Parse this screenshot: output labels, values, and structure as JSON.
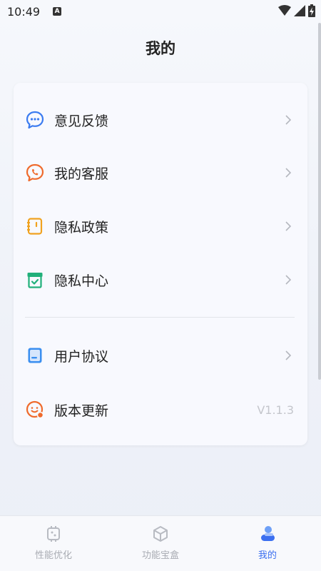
{
  "status_bar": {
    "time": "10:49",
    "notification_letter": "A"
  },
  "header": {
    "title": "我的"
  },
  "menu": {
    "items": [
      {
        "label": "意见反馈",
        "icon": "feedback-chat-icon",
        "color": "#3b7bf0"
      },
      {
        "label": "我的客服",
        "icon": "customer-service-phone-icon",
        "color": "#ef6a2c"
      },
      {
        "label": "隐私政策",
        "icon": "privacy-policy-notebook-icon",
        "color": "#f0a21f"
      },
      {
        "label": "隐私中心",
        "icon": "privacy-center-box-icon",
        "color": "#21b07a"
      }
    ],
    "secondary_items": [
      {
        "label": "用户协议",
        "icon": "user-agreement-icon",
        "color": "#3b8ff0"
      },
      {
        "label": "版本更新",
        "icon": "version-update-smile-icon",
        "color": "#ef6a2c",
        "version": "V1.1.3"
      }
    ]
  },
  "bottom_nav": {
    "tabs": [
      {
        "label": "性能优化",
        "icon": "performance-chip-icon",
        "active": false
      },
      {
        "label": "功能宝盒",
        "icon": "feature-box-icon",
        "active": false
      },
      {
        "label": "我的",
        "icon": "profile-user-icon",
        "active": true
      }
    ],
    "active_color": "#3b6ff0"
  }
}
